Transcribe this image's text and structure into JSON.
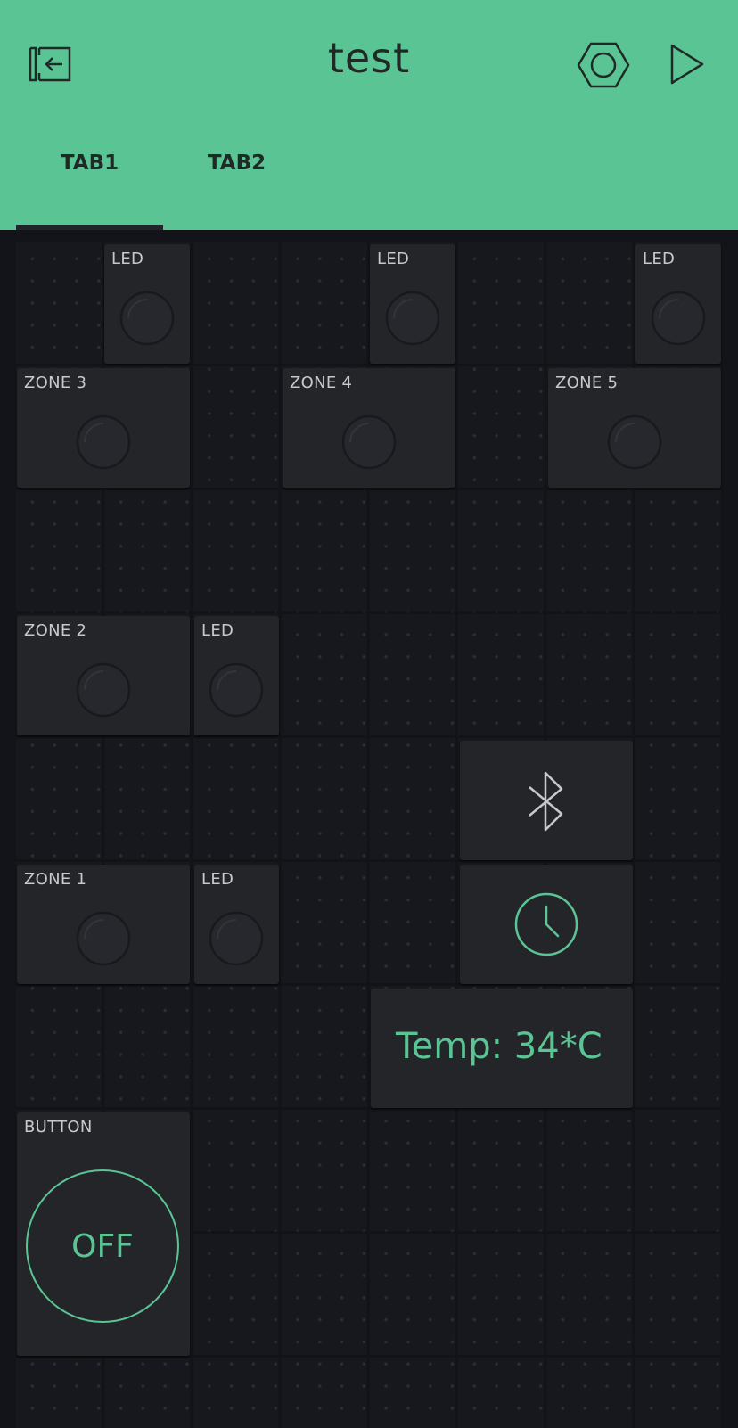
{
  "app": {
    "title": "test"
  },
  "header": {
    "icons": {
      "exit": "exit-icon",
      "settings": "settings-hexagon-icon",
      "play": "play-icon"
    },
    "accent": "#5bc494"
  },
  "tabs": [
    {
      "label": "TAB1",
      "active": true
    },
    {
      "label": "TAB2",
      "active": false
    }
  ],
  "widgets": {
    "led_top_1": {
      "label": "LED"
    },
    "led_top_2": {
      "label": "LED"
    },
    "led_top_3": {
      "label": "LED"
    },
    "zone3": {
      "label": "ZONE 3"
    },
    "zone4": {
      "label": "ZONE 4"
    },
    "zone5": {
      "label": "ZONE 5"
    },
    "zone2": {
      "label": "ZONE 2"
    },
    "led_zone2": {
      "label": "LED"
    },
    "zone1": {
      "label": "ZONE 1"
    },
    "led_zone1": {
      "label": "LED"
    },
    "bluetooth": {
      "icon": "bluetooth-icon"
    },
    "rtc": {
      "icon": "clock-icon"
    },
    "temp": {
      "value": "Temp: 34*C"
    },
    "button": {
      "label": "BUTTON",
      "state": "OFF"
    }
  }
}
